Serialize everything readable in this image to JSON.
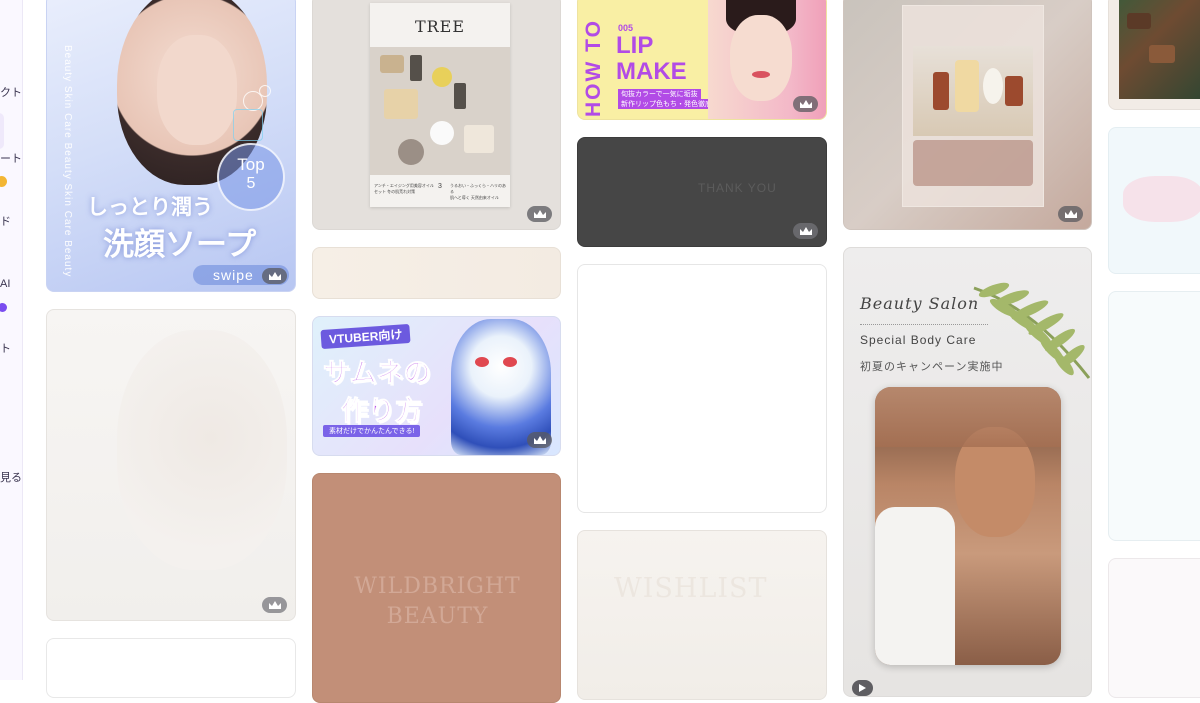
{
  "sidebar": {
    "fragments": [
      "クト",
      "ート",
      "ド",
      "AI",
      "ト",
      "見る"
    ]
  },
  "cards": {
    "skin": {
      "vertical_text": "Beauty Skin Care  Beauty Skin Care  Beauty",
      "top_label": "Top",
      "top_number": "5",
      "title_line1": "しっとり潤う",
      "title_line2": "洗顔ソープ",
      "swipe": "swipe"
    },
    "tree": {
      "title": "TREE",
      "footer_left": "アンチ・エイジング用美容オイル\nセット 冬の肌荒れ対策",
      "footer_num": "3",
      "footer_right": "うるおい・ふっくら・ハリのある\n肌へと導く 天然由来オイル"
    },
    "lip": {
      "side": "HOW TO",
      "num": "005",
      "line1": "LIP",
      "line2": "MAKE",
      "sub1": "旬抜カラーで一気に垢抜",
      "sub2": "新作リップ色もち・発色徹底検証"
    },
    "thank": {
      "text": "THANK YOU"
    },
    "vtuber": {
      "line1": "VTUBER向け",
      "line2": "サムネの",
      "line3": "作り方",
      "sub": "素材だけでかんたんできる!"
    },
    "wildbright": {
      "line1": "WILDBRIGHT",
      "line2": "BEAUTY"
    },
    "wishlist": {
      "text": "WISHLIST"
    },
    "salon": {
      "script": "Beauty Salon",
      "sub": "Special Body Care",
      "jp": "初夏のキャンペーン実施中"
    },
    "colors": {
      "lip_purple": "#b24be6",
      "thank_bg": "#464646",
      "wild_bg": "#c28f78"
    }
  }
}
